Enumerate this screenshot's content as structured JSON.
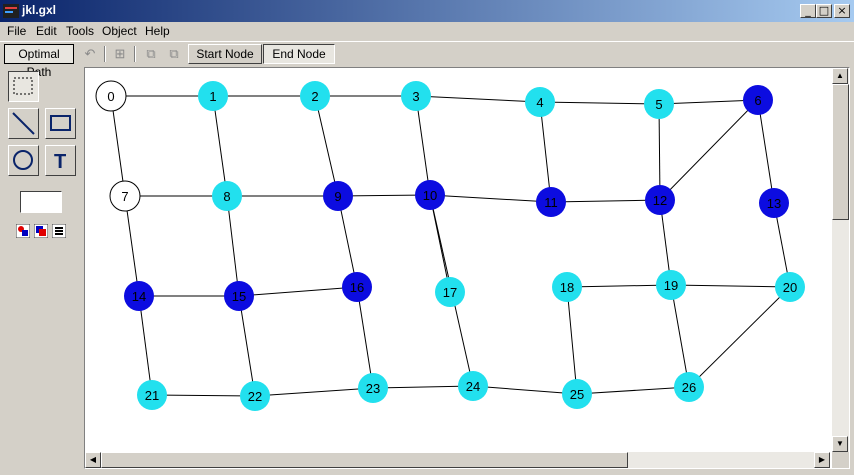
{
  "window": {
    "title": "jkl.gxl"
  },
  "menu": {
    "items": [
      "File",
      "Edit",
      "Tools",
      "Object",
      "Help"
    ]
  },
  "toolbar": {
    "optimal_path_label": "Optimal Path",
    "start_node_label": "Start Node",
    "end_node_label": "End Node"
  },
  "palette": {
    "tools": [
      "select-tool",
      "line-tool",
      "rectangle-tool",
      "ellipse-tool",
      "text-tool"
    ],
    "fill_color": "#ffffff"
  },
  "colors": {
    "unvisited_node": "#ffffff",
    "cyan_node": "#22e0ee",
    "blue_node": "#0c0ce0",
    "edge": "#000000"
  },
  "graph": {
    "nodes": [
      {
        "id": "0",
        "state": "white"
      },
      {
        "id": "1",
        "state": "cyan"
      },
      {
        "id": "2",
        "state": "cyan"
      },
      {
        "id": "3",
        "state": "cyan"
      },
      {
        "id": "4",
        "state": "cyan"
      },
      {
        "id": "5",
        "state": "cyan"
      },
      {
        "id": "6",
        "state": "blue"
      },
      {
        "id": "7",
        "state": "white"
      },
      {
        "id": "8",
        "state": "cyan"
      },
      {
        "id": "9",
        "state": "blue"
      },
      {
        "id": "10",
        "state": "blue"
      },
      {
        "id": "11",
        "state": "blue"
      },
      {
        "id": "12",
        "state": "blue"
      },
      {
        "id": "13",
        "state": "blue"
      },
      {
        "id": "14",
        "state": "blue"
      },
      {
        "id": "15",
        "state": "blue"
      },
      {
        "id": "16",
        "state": "blue"
      },
      {
        "id": "17",
        "state": "cyan"
      },
      {
        "id": "18",
        "state": "cyan"
      },
      {
        "id": "19",
        "state": "cyan"
      },
      {
        "id": "20",
        "state": "cyan"
      },
      {
        "id": "21",
        "state": "cyan"
      },
      {
        "id": "22",
        "state": "cyan"
      },
      {
        "id": "23",
        "state": "cyan"
      },
      {
        "id": "24",
        "state": "cyan"
      },
      {
        "id": "25",
        "state": "cyan"
      },
      {
        "id": "26",
        "state": "cyan"
      }
    ],
    "edges": [
      [
        "0",
        "1"
      ],
      [
        "1",
        "2"
      ],
      [
        "2",
        "3"
      ],
      [
        "3",
        "4"
      ],
      [
        "4",
        "5"
      ],
      [
        "5",
        "6"
      ],
      [
        "0",
        "7"
      ],
      [
        "1",
        "8"
      ],
      [
        "2",
        "9"
      ],
      [
        "3",
        "10"
      ],
      [
        "4",
        "11"
      ],
      [
        "5",
        "12"
      ],
      [
        "6",
        "12"
      ],
      [
        "6",
        "13"
      ],
      [
        "7",
        "8"
      ],
      [
        "8",
        "9"
      ],
      [
        "9",
        "10"
      ],
      [
        "10",
        "11"
      ],
      [
        "11",
        "12"
      ],
      [
        "7",
        "14"
      ],
      [
        "8",
        "15"
      ],
      [
        "9",
        "16"
      ],
      [
        "10",
        "17"
      ],
      [
        "12",
        "19"
      ],
      [
        "13",
        "20"
      ],
      [
        "14",
        "15"
      ],
      [
        "15",
        "16"
      ],
      [
        "18",
        "19"
      ],
      [
        "19",
        "20"
      ],
      [
        "14",
        "21"
      ],
      [
        "15",
        "22"
      ],
      [
        "16",
        "23"
      ],
      [
        "10",
        "24"
      ],
      [
        "18",
        "25"
      ],
      [
        "19",
        "26"
      ],
      [
        "20",
        "26"
      ],
      [
        "21",
        "22"
      ],
      [
        "22",
        "23"
      ],
      [
        "23",
        "24"
      ],
      [
        "24",
        "25"
      ],
      [
        "25",
        "26"
      ]
    ]
  }
}
